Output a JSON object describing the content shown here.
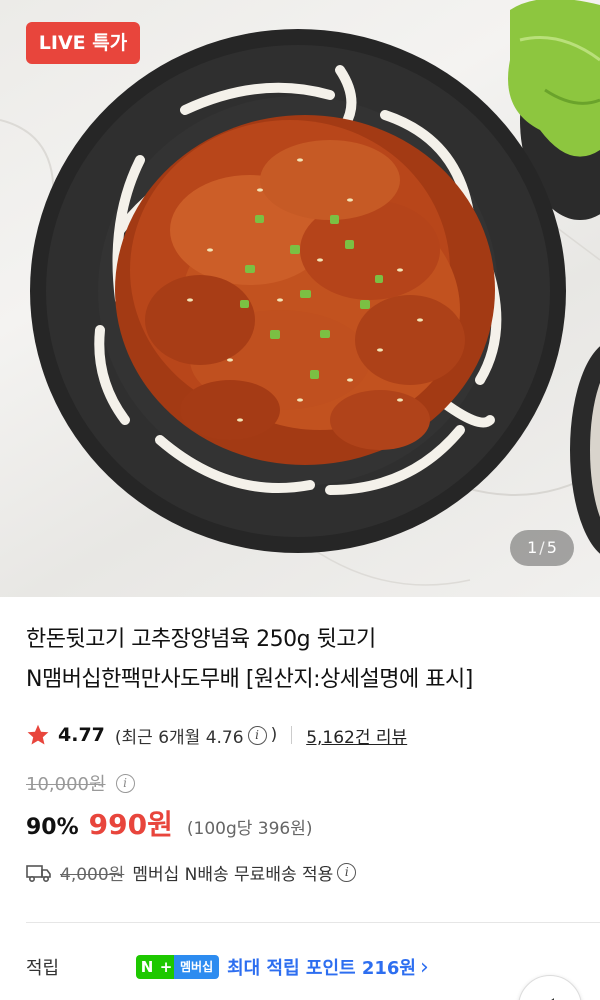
{
  "hero": {
    "badge": "LIVE 특가",
    "page_current": "1",
    "page_total": "5"
  },
  "product": {
    "title_line1": "한돈뒷고기 고추장양념육 250g 뒷고기",
    "title_line2": "N맴버십한팩만사도무배 [원산지:상세설명에 표시]"
  },
  "rating": {
    "score": "4.77",
    "recent": "(최근 6개월 4.76",
    "recent_close": ")",
    "reviews": "5,162건 리뷰"
  },
  "price": {
    "original": "10,000원",
    "discount": "90%",
    "sale": "990원",
    "unit": "(100g당 396원)"
  },
  "shipping": {
    "original_fee": "4,000원",
    "text": "멤버십 N배송 무료배송 적용"
  },
  "points": {
    "label": "적립",
    "badge_n": "N",
    "badge_plus": "+",
    "badge_member": "멤버십",
    "text": "최대 적립 포인트 216원",
    "chevron": "›"
  },
  "icons": {
    "rating_star": "star-icon",
    "info": "info-icon",
    "shipping": "truck-icon",
    "share": "share-icon"
  },
  "colors": {
    "accent_red": "#e8453c",
    "naver_green": "#1ec800",
    "link_blue": "#2d6ef0"
  }
}
